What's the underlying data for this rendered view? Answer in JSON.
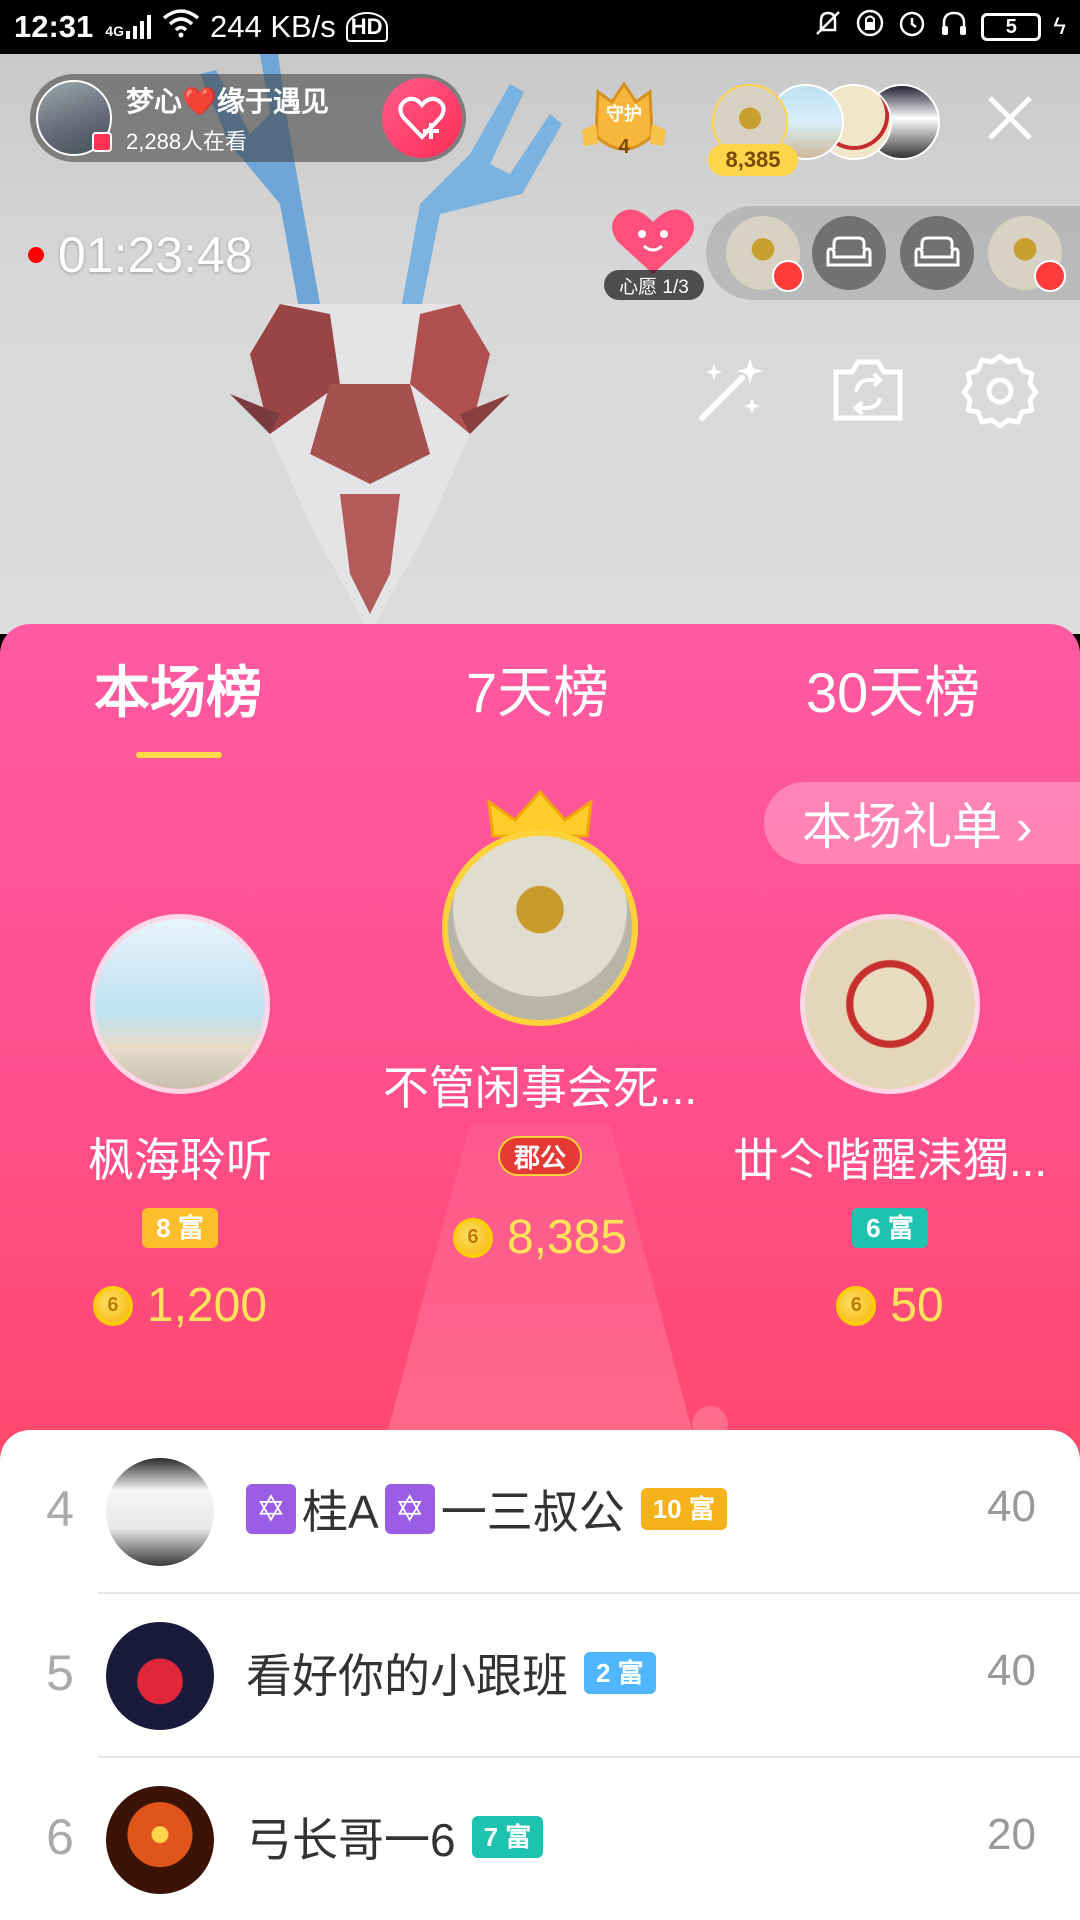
{
  "statusbar": {
    "time": "12:31",
    "network": "4G",
    "speed": "244 KB/s",
    "hd": "HD",
    "battery": "5"
  },
  "host": {
    "name": "梦心❤️缘于遇见",
    "viewers": "2,288人在看"
  },
  "guard": {
    "label": "守护",
    "count": "4"
  },
  "top_viewers": {
    "coins": "8,385"
  },
  "timer": "01:23:48",
  "wish": {
    "label": "心愿 1/3"
  },
  "tabs": [
    {
      "label": "本场榜"
    },
    {
      "label": "7天榜"
    },
    {
      "label": "30天榜"
    }
  ],
  "gift_list_btn": "本场礼单 ›",
  "podium": {
    "first": {
      "name": "不管闲事会死...",
      "badge": "郡公",
      "coins": "8,385"
    },
    "second": {
      "name": "枫海聆听",
      "badge": "8 富",
      "coins": "1,200"
    },
    "third": {
      "name": "丗仒喈醒洡獨...",
      "badge": "6 富",
      "coins": "50"
    }
  },
  "list": [
    {
      "rank": "4",
      "prefix": "✡",
      "name_a": "桂A",
      "name_b": "一三叔公",
      "level": "10 富",
      "score": "40",
      "level_color": "#f6b21a"
    },
    {
      "rank": "5",
      "name": "看好你的小跟班",
      "level": "2 富",
      "score": "40",
      "level_color": "#4fb6ff"
    },
    {
      "rank": "6",
      "name": "弓长哥一6",
      "level": "7 富",
      "score": "20",
      "level_color": "#1ec3b0"
    }
  ],
  "coin_glyph": "6"
}
